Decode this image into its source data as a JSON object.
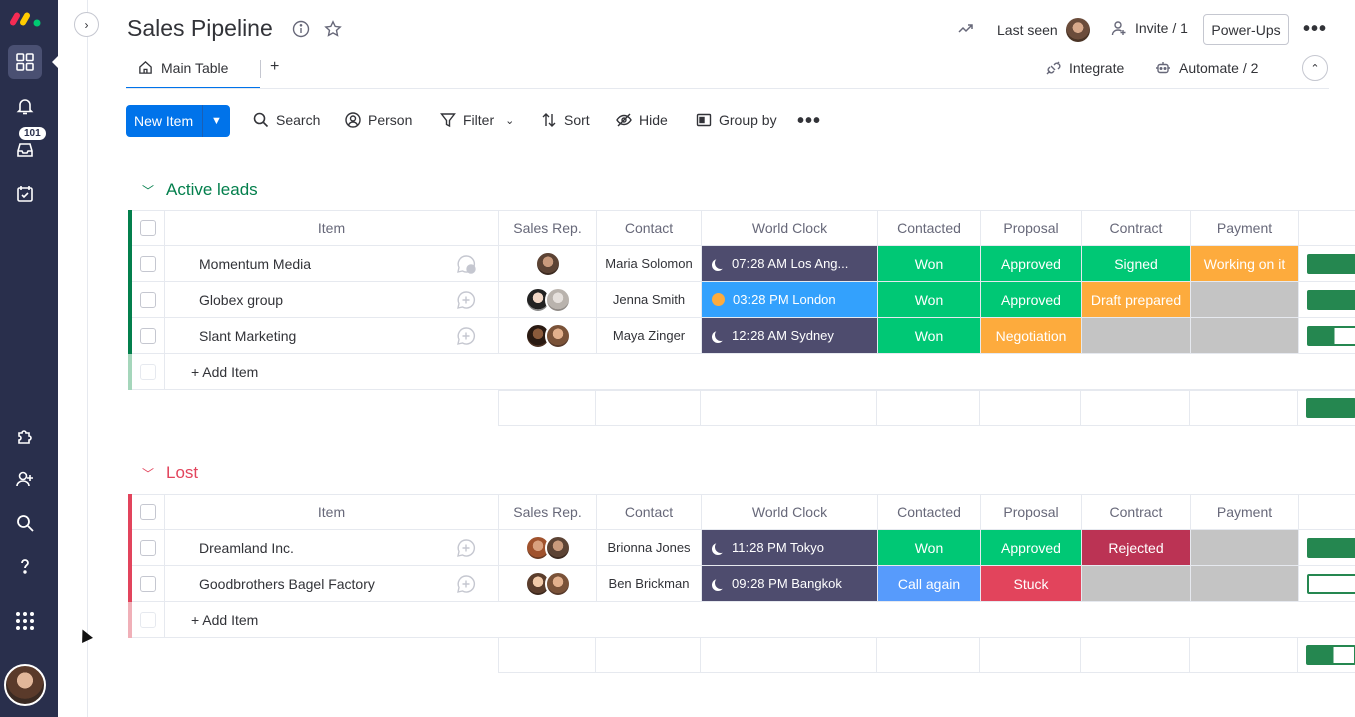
{
  "rail": {
    "badge": "101"
  },
  "header": {
    "title": "Sales Pipeline",
    "last_seen": "Last seen",
    "invite": "Invite / 1",
    "powerups": "Power-Ups",
    "more": "•••"
  },
  "tabs": {
    "main": "Main Table",
    "add": "+",
    "integrate": "Integrate",
    "automate": "Automate / 2"
  },
  "toolbar": {
    "new_item": "New Item",
    "search": "Search",
    "person": "Person",
    "filter": "Filter",
    "sort": "Sort",
    "hide": "Hide",
    "group_by": "Group by",
    "more": "•••"
  },
  "columns": [
    "Item",
    "Sales Rep.",
    "Contact",
    "World Clock",
    "Contacted",
    "Proposal",
    "Contract",
    "Payment"
  ],
  "colors": {
    "accent": "#0073ea",
    "done_green": "#00c875",
    "working_orange": "#fdab3d",
    "stuck_red": "#e2445c",
    "rejected_red": "#bb3354",
    "blank_grey": "#c4c4c4",
    "night_clock": "#4e4c6e",
    "day_clock": "#33a1fd",
    "call_again_blue": "#579bfc",
    "group_green": "#037f4c",
    "group_red": "#e2445c"
  },
  "groups": [
    {
      "title": "Active leads",
      "color": "#037f4c",
      "add_item": "+ Add Item",
      "rows": [
        {
          "item": "Momentum Media",
          "contact": "Maria Solomon",
          "clock": "07:28 AM Los Ang...",
          "clock_mode": "night",
          "contacted": "Won",
          "proposal": "Approved",
          "contract": "Signed",
          "payment": "Working on it",
          "progress": 1.0
        },
        {
          "item": "Globex group",
          "contact": "Jenna Smith",
          "clock": "03:28 PM London",
          "clock_mode": "day",
          "contacted": "Won",
          "proposal": "Approved",
          "contract": "Draft prepared",
          "payment": "",
          "progress": 1.0
        },
        {
          "item": "Slant Marketing",
          "contact": "Maya Zinger",
          "clock": "12:28 AM Sydney",
          "clock_mode": "night",
          "contacted": "Won",
          "proposal": "Negotiation",
          "contract": "",
          "payment": "",
          "progress": 0.55
        }
      ]
    },
    {
      "title": "Lost",
      "color": "#e2445c",
      "add_item": "+ Add Item",
      "rows": [
        {
          "item": "Dreamland Inc.",
          "contact": "Brionna Jones",
          "clock": "11:28 PM Tokyo",
          "clock_mode": "night",
          "contacted": "Won",
          "proposal": "Approved",
          "contract": "Rejected",
          "payment": "",
          "progress": 1.0
        },
        {
          "item": "Goodbrothers Bagel Factory",
          "contact": "Ben Brickman",
          "clock": "09:28 PM Bangkok",
          "clock_mode": "night",
          "contacted": "Call again",
          "proposal": "Stuck",
          "contract": "",
          "payment": "",
          "progress": 0.0
        }
      ]
    }
  ]
}
